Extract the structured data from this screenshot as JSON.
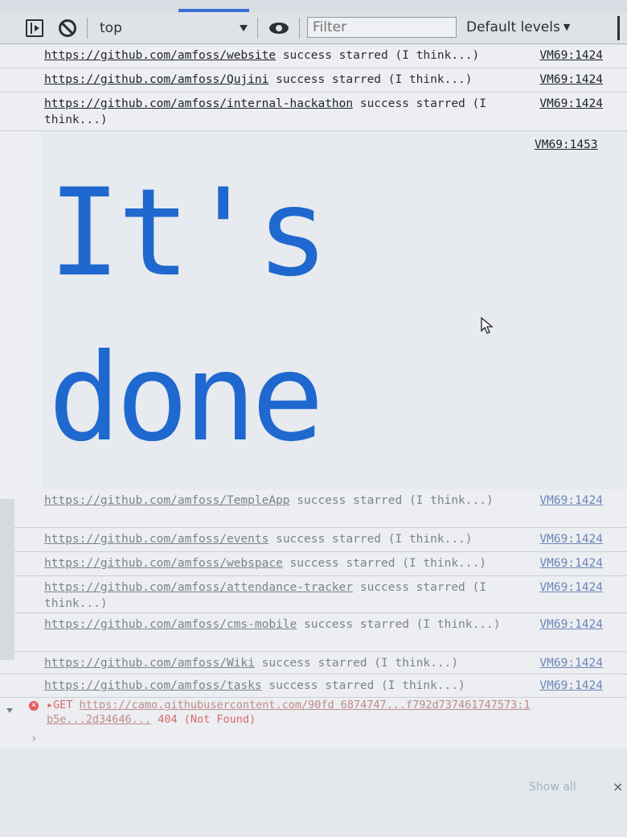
{
  "toolbar": {
    "context": "top",
    "filter_placeholder": "Filter",
    "levels": "Default levels",
    "levels_caret": "▼"
  },
  "messages_top": [
    {
      "link": "https://github.com/amfoss/website",
      "text": " success starred (I think...)",
      "source": "VM69:1424"
    },
    {
      "link": "https://github.com/amfoss/Qujini",
      "text": " success starred (I think...)",
      "source": "VM69:1424"
    },
    {
      "link": "https://github.com/amfoss/internal-hackathon",
      "text": " success starred (I think...)",
      "source": "VM69:1424"
    }
  ],
  "styled_log": {
    "source": "VM69:1453",
    "line1": "It's",
    "line2": "done"
  },
  "messages_bottom": [
    {
      "link": "https://github.com/amfoss/TempleApp",
      "text": " success starred (I think...)",
      "source": "VM69:1424"
    },
    {
      "link": "https://github.com/amfoss/events",
      "text": " success starred (I think...)",
      "source": "VM69:1424"
    },
    {
      "link": "https://github.com/amfoss/webspace",
      "text": " success starred (I think...)",
      "source": "VM69:1424"
    },
    {
      "link": "https://github.com/amfoss/attendance-tracker",
      "text": " success starred (I think...)",
      "source": "VM69:1424"
    },
    {
      "link": "https://github.com/amfoss/cms-mobile",
      "text": " success starred (I think...)",
      "source": "VM69:1424"
    },
    {
      "link": "https://github.com/amfoss/Wiki",
      "text": " success starred (I think...)",
      "source": "VM69:1424"
    },
    {
      "link": "https://github.com/amfoss/tasks",
      "text": " success starred (I think...)",
      "source": "VM69:1424"
    }
  ],
  "error": {
    "method": "▸GET",
    "url": "https://camo.githubusercontent.com/90fd 6874747...f792d737461747573:1 b5e...2d34646...",
    "status": "404 (Not Found)"
  },
  "prompt": "›",
  "footer": {
    "show_all": "Show all",
    "close": "×"
  }
}
